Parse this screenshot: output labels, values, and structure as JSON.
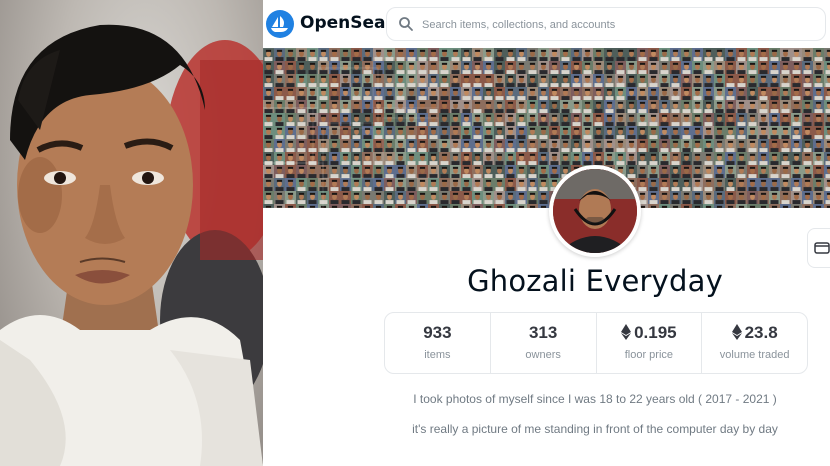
{
  "header": {
    "brand": "OpenSea",
    "search_placeholder": "Search items, collections, and accounts"
  },
  "profile": {
    "title": "Ghozali Everyday"
  },
  "stats": [
    {
      "value": "933",
      "label": "items",
      "eth": false
    },
    {
      "value": "313",
      "label": "owners",
      "eth": false
    },
    {
      "value": "0.195",
      "label": "floor price",
      "eth": true
    },
    {
      "value": "23.8",
      "label": "volume traded",
      "eth": true
    }
  ],
  "description": {
    "line1": "I took photos of myself since I was 18 to 22 years old ( 2017 - 2021 )",
    "line2": "it's really a picture of me standing in front of the computer day by day"
  },
  "colors": {
    "brand_blue": "#2081e2",
    "text_dark": "#04111d",
    "text_muted": "#8a939b"
  },
  "icons": [
    "opensea-logo-icon",
    "search-icon",
    "ethereum-icon",
    "wallet-icon"
  ]
}
